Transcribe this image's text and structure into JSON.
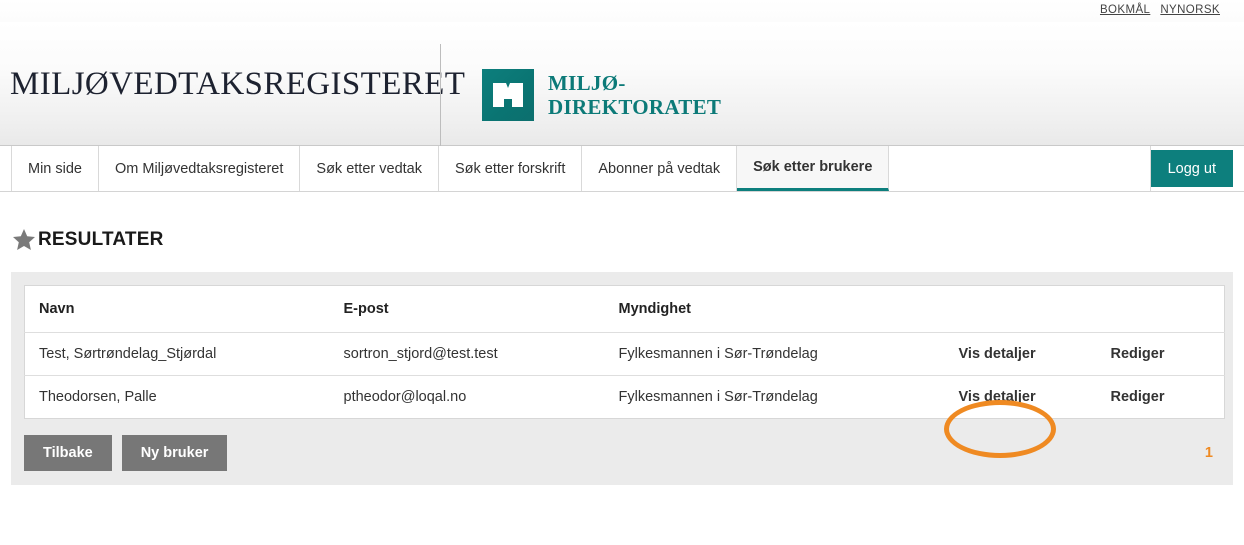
{
  "language_bar": {
    "links": [
      {
        "label": "BOKMÅL",
        "name": "bokmal"
      },
      {
        "label": "NYNORSK",
        "name": "nynorsk"
      }
    ]
  },
  "masthead": {
    "site_title": "MILJØVEDTAKSREGISTERET",
    "agency_logo": {
      "icon": "open-book-mark",
      "line1": "MILJØ-",
      "line2": "DIREKTORATET",
      "color": "#0d7f7d"
    }
  },
  "nav": {
    "tabs": [
      {
        "label": "Min side",
        "active": false
      },
      {
        "label": "Om Miljøvedtaksregisteret",
        "active": false
      },
      {
        "label": "Søk etter vedtak",
        "active": false
      },
      {
        "label": "Søk etter forskrift",
        "active": false
      },
      {
        "label": "Abonner på vedtak",
        "active": false
      },
      {
        "label": "Søk etter brukere",
        "active": true
      }
    ],
    "logout_label": "Logg ut",
    "accent_color": "#0d7f7d"
  },
  "results": {
    "heading": "RESULTATER",
    "heading_icon": "star-icon",
    "columns": [
      "Navn",
      "E-post",
      "Myndighet",
      "",
      ""
    ],
    "rows": [
      {
        "navn": "Test, Sørtrøndelag_Stjørdal",
        "epost": "sortron_stjord@test.test",
        "myndighet": "Fylkesmannen i Sør-Trøndelag",
        "vis": "Vis detaljer",
        "rediger": "Rediger"
      },
      {
        "navn": "Theodorsen, Palle",
        "epost": "ptheodor@loqal.no",
        "myndighet": "Fylkesmannen i Sør-Trøndelag",
        "vis": "Vis detaljer",
        "rediger": "Rediger"
      }
    ],
    "buttons": {
      "back": "Tilbake",
      "new_user": "Ny bruker"
    },
    "pagination": {
      "current_page": "1",
      "color": "#ef8a22"
    }
  },
  "annotation": {
    "shape": "ellipse",
    "color": "#ef8a22",
    "targets": "row-2-vis-detaljer"
  }
}
